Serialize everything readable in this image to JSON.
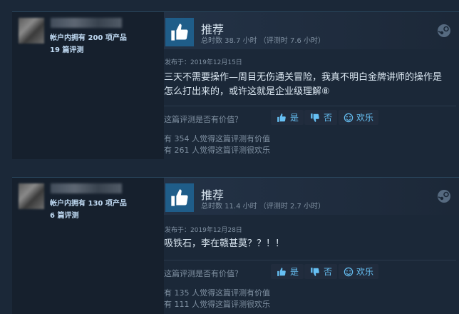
{
  "reviews": [
    {
      "owned": "帐户内拥有 200 项产品",
      "review_count": "19 篇评测",
      "title": "推荐",
      "hours": "总时数 38.7 小时 （评测时 7.6 小时）",
      "posted": "发布于：2019年12月15日",
      "content": "三天不需要操作—周目无伤通关冒险，我真不明白金牌讲师的操作是怎么打出来的，或许这就是企业级理解⑧",
      "helpful_question": "这篇评测是否有价值？",
      "yes": "是",
      "no": "否",
      "funny": "欢乐",
      "helpful_stat": "有 354 人觉得这篇评测有价值",
      "funny_stat": "有 261 人觉得这篇评测很欢乐"
    },
    {
      "owned": "帐户内拥有 130 项产品",
      "review_count": "6 篇评测",
      "title": "推荐",
      "hours": "总时数 11.4 小时 （评测时 2.7 小时）",
      "posted": "发布于：2019年12月28日",
      "content": "吸铁石，李在赣甚莫？？！！",
      "helpful_question": "这篇评测是否有价值？",
      "yes": "是",
      "no": "否",
      "funny": "欢乐",
      "helpful_stat": "有 135 人觉得这篇评测有价值",
      "funny_stat": "有 111 人觉得这篇评测很欢乐"
    }
  ],
  "icons": {
    "recommend": "thumbs-up-icon",
    "platform": "steam-icon",
    "yes": "thumbs-up-icon",
    "no": "thumbs-down-icon",
    "funny": "smiley-icon"
  },
  "colors": {
    "background": "#1b2838",
    "accent": "#66c0f4",
    "thumb_box": "#1f5d89"
  }
}
